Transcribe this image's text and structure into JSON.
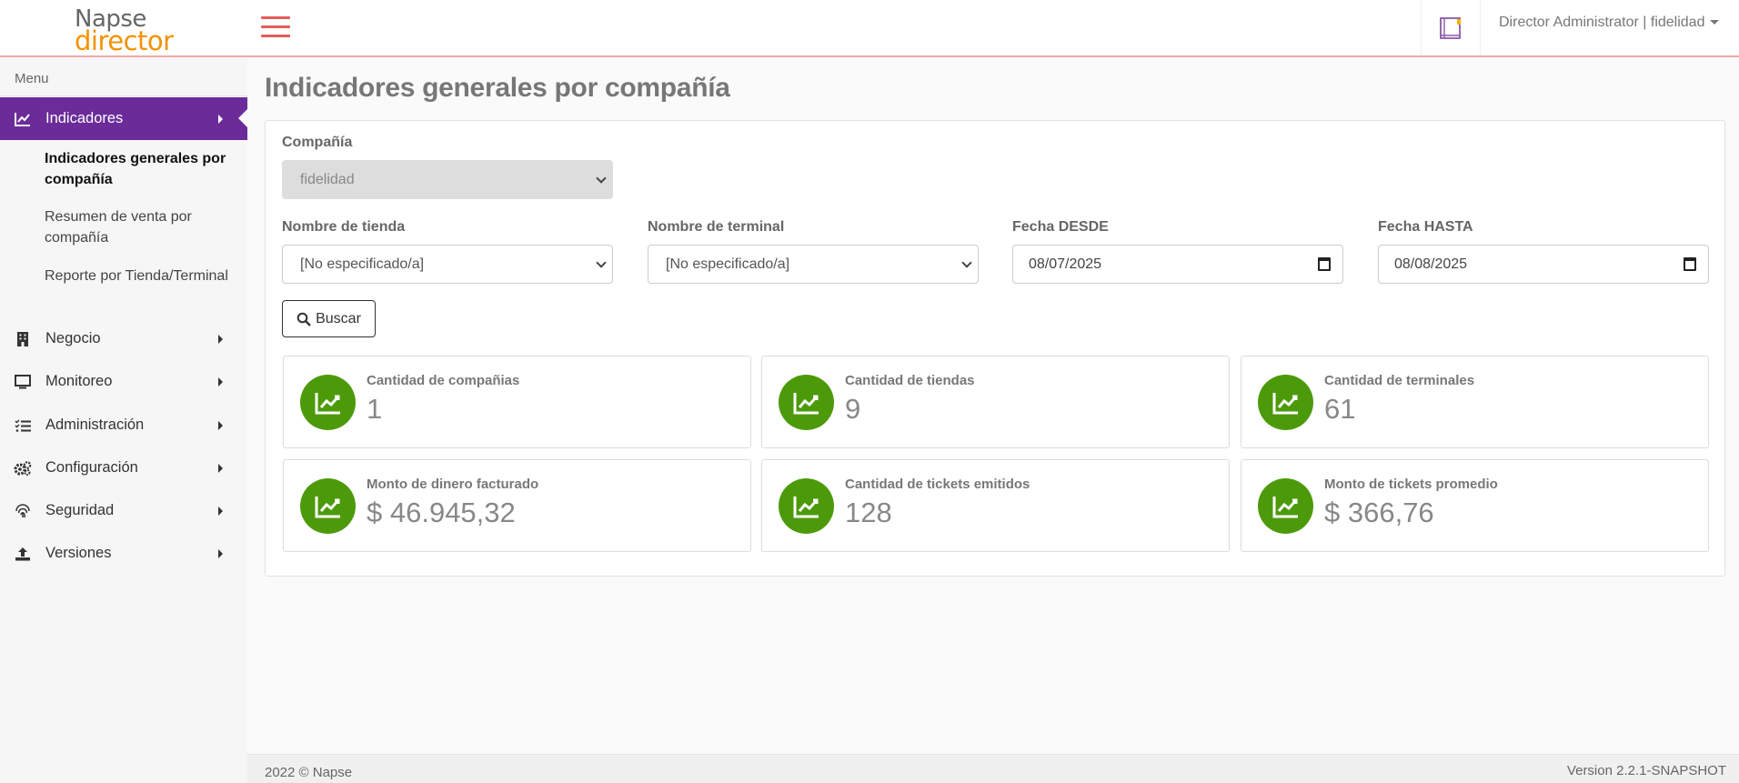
{
  "header": {
    "logo_line1": "Napse",
    "logo_line2": "director",
    "user_label": "Director Administrator | fidelidad"
  },
  "sidebar": {
    "heading": "Menu",
    "items": [
      {
        "label": "Indicadores",
        "icon": "chart-line-icon",
        "active": true
      },
      {
        "label": "Negocio",
        "icon": "building-icon"
      },
      {
        "label": "Monitoreo",
        "icon": "monitor-icon"
      },
      {
        "label": "Administración",
        "icon": "list-check-icon"
      },
      {
        "label": "Configuración",
        "icon": "gears-icon"
      },
      {
        "label": "Seguridad",
        "icon": "fingerprint-icon"
      },
      {
        "label": "Versiones",
        "icon": "upload-icon"
      }
    ],
    "submenu": [
      {
        "label": "Indicadores generales por compañía",
        "current": true
      },
      {
        "label": "Resumen de venta por compañía"
      },
      {
        "label": "Reporte por Tienda/Terminal"
      }
    ]
  },
  "main": {
    "title": "Indicadores generales por compañía",
    "filters": {
      "company_label": "Compañía",
      "company_value": "fidelidad",
      "store_label": "Nombre de tienda",
      "store_value": "[No especificado/a]",
      "terminal_label": "Nombre de terminal",
      "terminal_value": "[No especificado/a]",
      "from_label": "Fecha DESDE",
      "from_value": "08/07/2025",
      "to_label": "Fecha HASTA",
      "to_value": "08/08/2025"
    },
    "search_button": "Buscar",
    "cards": [
      {
        "label": "Cantidad de compañias",
        "value": "1"
      },
      {
        "label": "Cantidad de tiendas",
        "value": "9"
      },
      {
        "label": "Cantidad de terminales",
        "value": "61"
      },
      {
        "label": "Monto de dinero facturado",
        "value": "$ 46.945,32"
      },
      {
        "label": "Cantidad de tickets emitidos",
        "value": "128"
      },
      {
        "label": "Monto de tickets promedio",
        "value": "$ 366,76"
      }
    ],
    "card_icon": "chart-area-icon",
    "card_color": "#4c9a0a",
    "accent_color": "#6b2c9a"
  },
  "footer": {
    "copyright": "2022 © Napse",
    "version": "Version 2.2.1-SNAPSHOT"
  }
}
